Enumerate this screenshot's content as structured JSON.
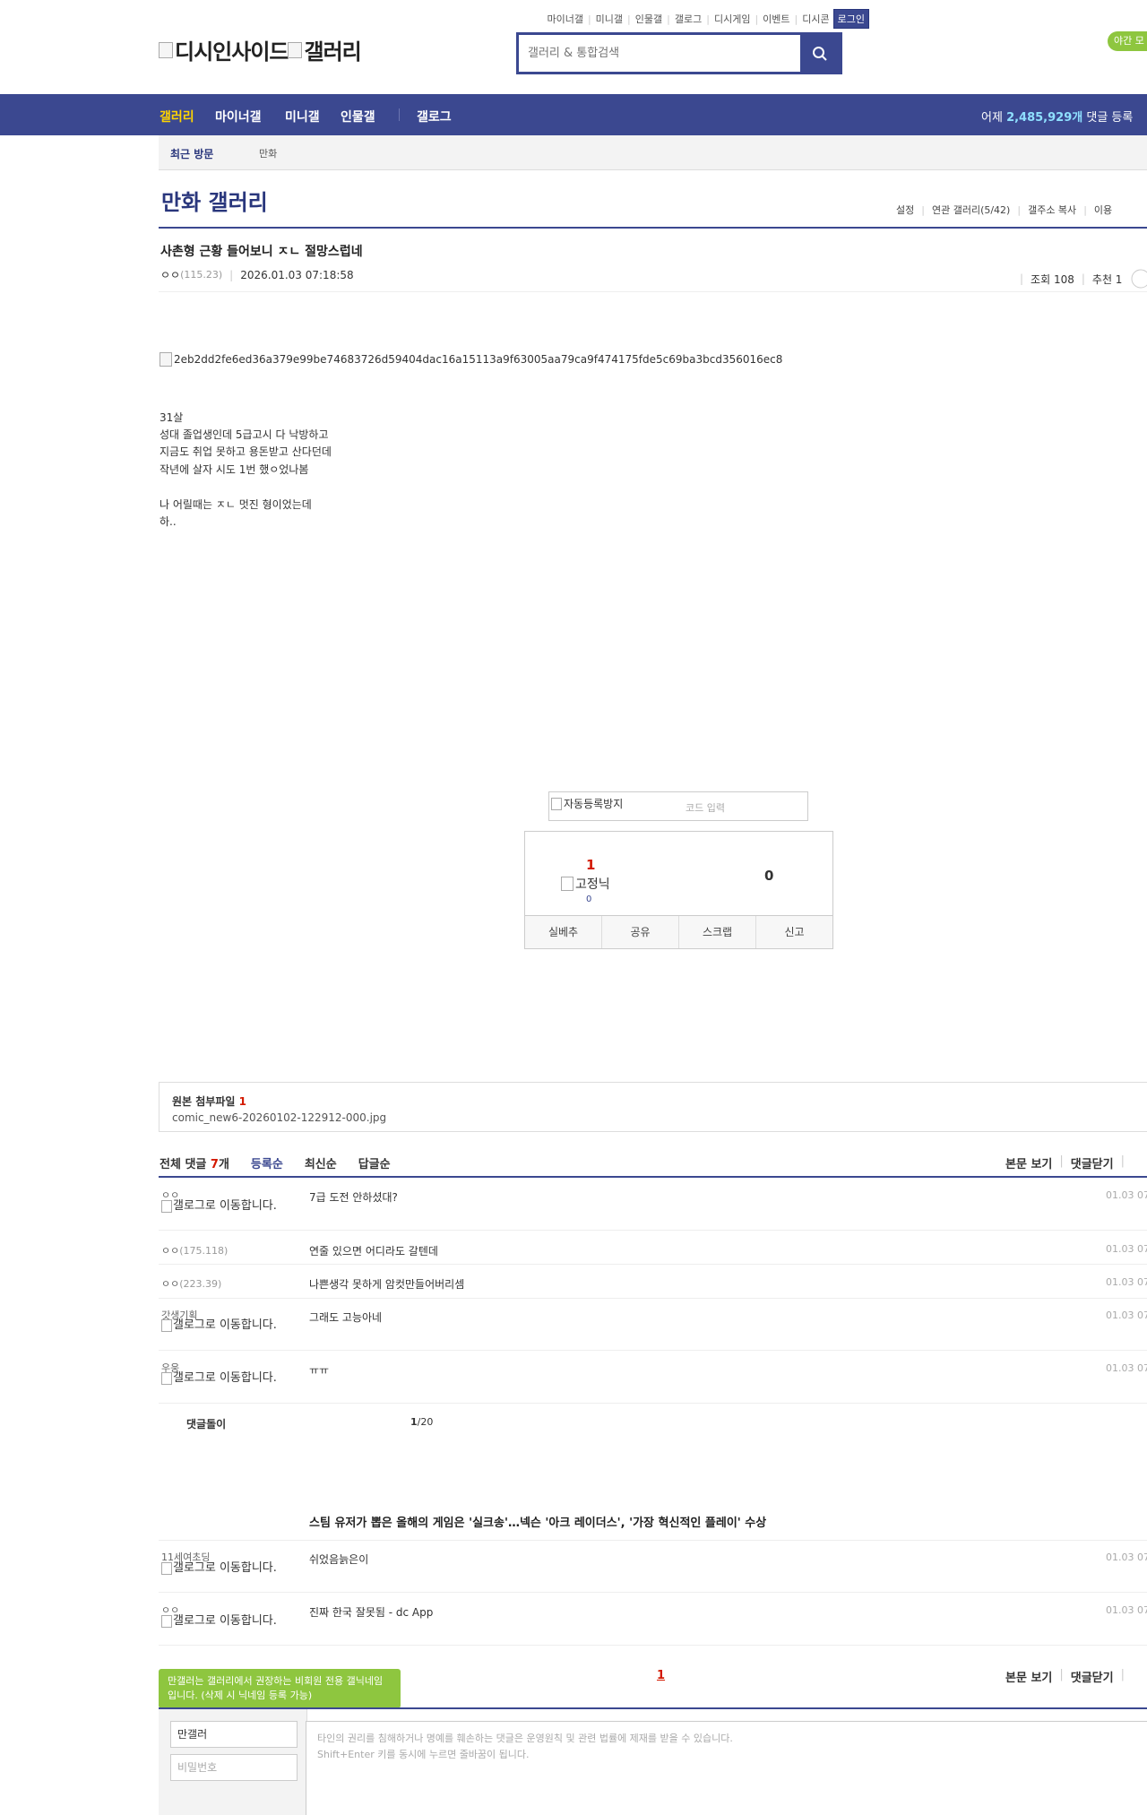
{
  "header": {
    "top_links": [
      "마이너갤",
      "미니갤",
      "인물갤",
      "갤로그",
      "디시게임",
      "이벤트",
      "디시콘"
    ],
    "login_label": "로그인",
    "night_mode_label": "야간 모",
    "logo_alt_1": "디시인사이드",
    "logo_alt_2": "갤러리",
    "search_placeholder": "갤러리 & 통합검색"
  },
  "gnb": {
    "items": [
      "갤러리",
      "마이너갤",
      "미니갤",
      "인물갤",
      "갤로그"
    ],
    "stats_prefix": "어제",
    "stats_count": "2,485,929개",
    "stats_suffix": "댓글 등록"
  },
  "recent": {
    "label": "최근 방문",
    "item": "만화"
  },
  "gallery": {
    "title": "만화 갤러리",
    "links": [
      "설정",
      "연관 갤러리(5/42)",
      "갤주소 복사",
      "이용"
    ]
  },
  "post": {
    "title": "사촌형 근황 들어보니 ㅈㄴ 절망스럽네",
    "nick": "ㅇㅇ",
    "ip": "(115.23)",
    "date": "2026.01.03 07:18:58",
    "views": "조회 108",
    "recommend": "추천 1",
    "image_alt": "2eb2dd2fe6ed36a379e99be74683726d59404dac16a15113a9f63005aa79ca9f474175fde5c69ba3bcd356016ec8",
    "body": [
      "31살",
      "성대 졸업생인데 5급고시 다 낙방하고",
      "지금도 취업 못하고 용돈받고 산다던데",
      "작년에 살자 시도 1번 했ㅇ었나봄",
      "",
      "나 어릴때는 ㅈㄴ 멋진 형이었는데",
      "하.."
    ]
  },
  "captcha": {
    "image_alt": "자동등록방지",
    "placeholder": "코드 입력"
  },
  "vote": {
    "up": "1",
    "fixed_alt": "고정닉",
    "fixed_count": "0",
    "down": "0",
    "buttons": [
      "실베추",
      "공유",
      "스크랩",
      "신고"
    ]
  },
  "attachment": {
    "label": "원본 첨부파일",
    "count": "1",
    "filename": "comic_new6-20260102-122912-000.jpg"
  },
  "comments": {
    "header_label": "전체 댓글",
    "count": "7",
    "unit": "개",
    "sorts": [
      "등록순",
      "최신순",
      "답글순"
    ],
    "tools": [
      "본문 보기",
      "댓글닫기"
    ],
    "gallog_alt": "갤로그로 이동합니다.",
    "items": [
      {
        "nick": "ㅇㅇ",
        "ip": "",
        "text": "7급 도전 안하셨대?",
        "date": "01.03 07"
      },
      {
        "nick": "ㅇㅇ",
        "ip": "(175.118)",
        "text": "연줄 있으면 어디라도 갈텐데",
        "date": "01.03 07"
      },
      {
        "nick": "ㅇㅇ",
        "ip": "(223.39)",
        "text": "나쁜생각 못하게 암컷만들어버리셈",
        "date": "01.03 07"
      },
      {
        "nick": "갓생기획",
        "ip": "",
        "text": "그래도 고능아네",
        "date": "01.03 07"
      },
      {
        "nick": "우웅",
        "ip": "",
        "text": "ㅠㅠ",
        "date": "01.03 07"
      }
    ],
    "bot_label": "댓글돌이",
    "bot_page_current": "1",
    "bot_page_total": "/20",
    "news_title": "스팀 유저가 뽑은 올해의 게임은 '실크송'…넥슨 '아크 레이더스', '가장 혁신적인 플레이' 수상",
    "items2": [
      {
        "nick": "11세여초딩",
        "text": "쉬었음늙은이",
        "date": "01.03 07"
      },
      {
        "nick": "ㅇㅇ",
        "text": "진짜 한국 잘못됨 - dc App",
        "date": "01.03 07"
      }
    ],
    "page": "1"
  },
  "write": {
    "tooltip": "만갤러는 갤러리에서 권장하는 비회원 전용 갤닉네임입니다. (삭제 시 닉네임 등록 가능)",
    "name_value": "만갤러",
    "pw_placeholder": "비밀번호",
    "textarea_line1": "타인의 권리를 침해하거나 명예를 훼손하는 댓글은 운영원칙 및 관련 법률에 제재를 받을 수 있습니다.",
    "textarea_line2": "Shift+Enter 키를 동시에 누르면 줄바꿈이 됩니다."
  },
  "colors": {
    "brand": "#3b4890",
    "accent": "#d31900",
    "green": "#8ec63f",
    "gnb_active": "#ffd400"
  }
}
